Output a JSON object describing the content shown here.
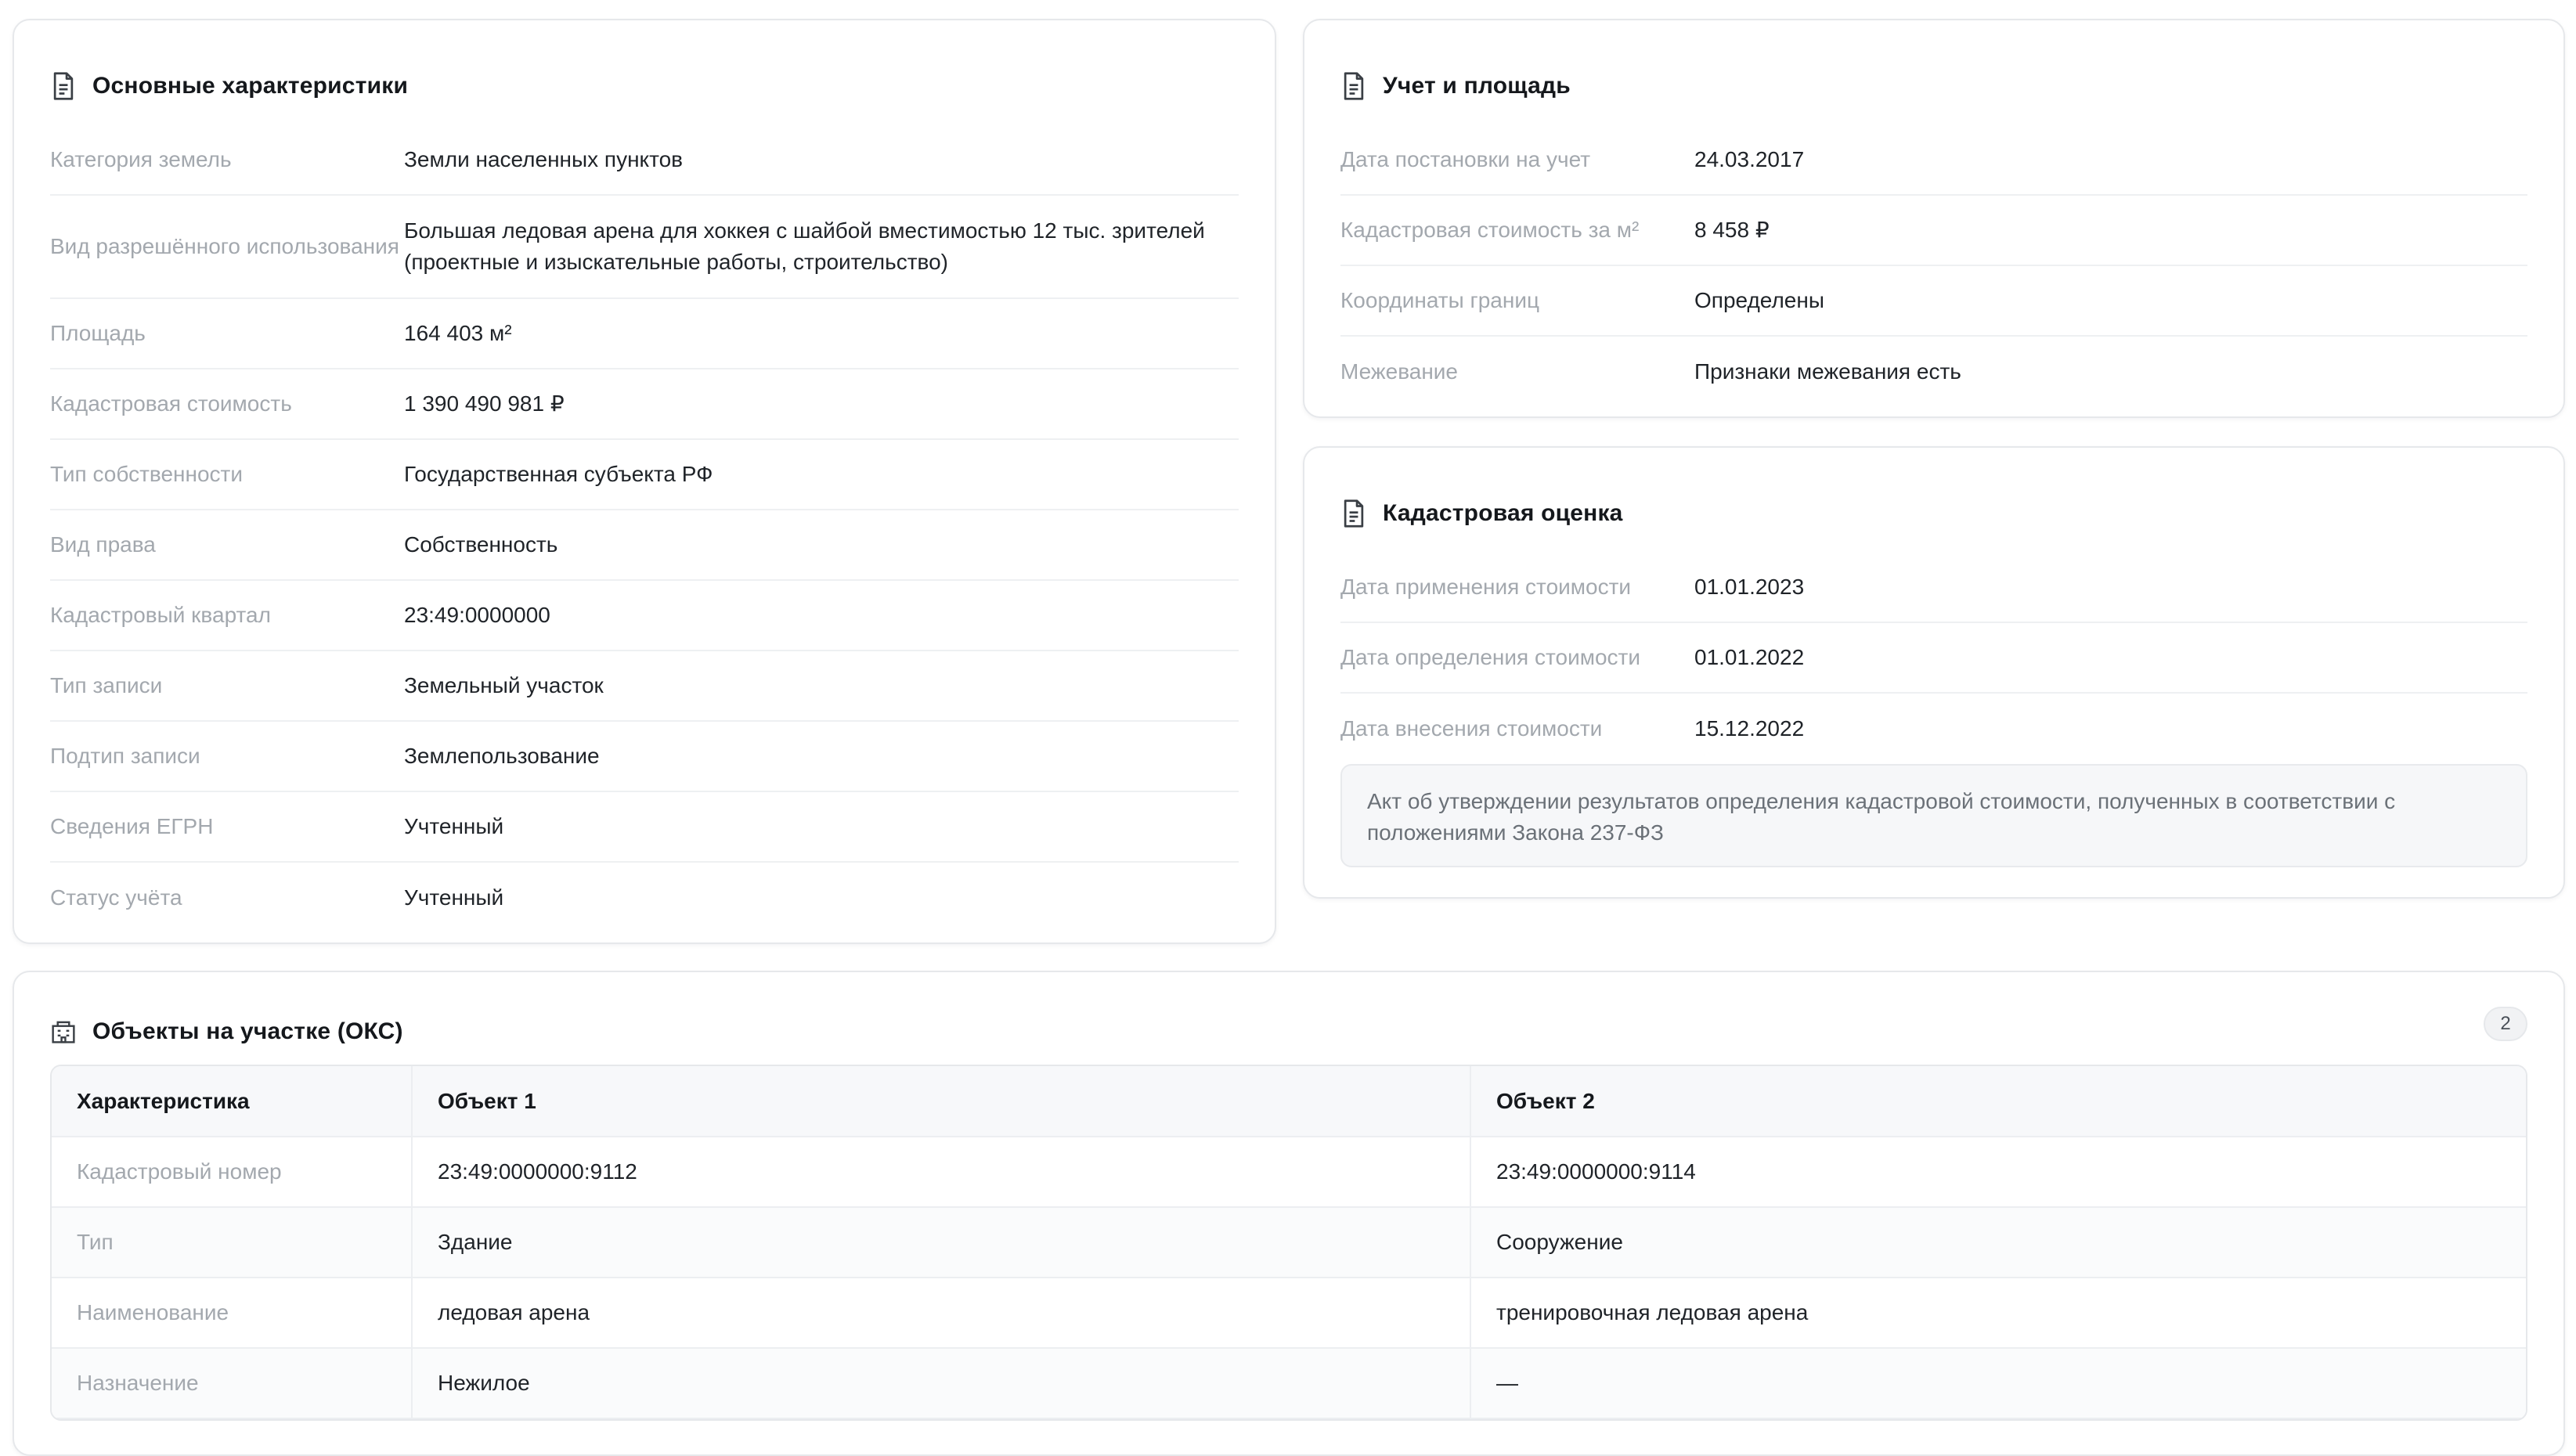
{
  "main": {
    "title": "Основные характеристики",
    "icon": "document-icon",
    "rows": [
      {
        "label": "Категория земель",
        "value": "Земли населенных пунктов"
      },
      {
        "label": "Вид разрешённого использования",
        "value": "Большая ледовая арена для хоккея с шайбой вместимостью 12 тыс. зрителей (проектные и изыскательные работы, строительство)"
      },
      {
        "label": "Площадь",
        "value": "164 403 м²"
      },
      {
        "label": "Кадастровая стоимость",
        "value": "1 390 490 981 ₽"
      },
      {
        "label": "Тип собственности",
        "value": "Государственная субъекта РФ"
      },
      {
        "label": "Вид права",
        "value": "Собственность"
      },
      {
        "label": "Кадастровый квартал",
        "value": "23:49:0000000"
      },
      {
        "label": "Тип записи",
        "value": "Земельный участок"
      },
      {
        "label": "Подтип записи",
        "value": "Землепользование"
      },
      {
        "label": "Сведения ЕГРН",
        "value": "Учтенный"
      },
      {
        "label": "Статус учёта",
        "value": "Учтенный"
      }
    ]
  },
  "registration": {
    "title": "Учет и площадь",
    "icon": "document-icon",
    "rows": [
      {
        "label": "Дата постановки на учет",
        "value": "24.03.2017"
      },
      {
        "label": "Кадастровая стоимость за м²",
        "value": "8 458 ₽"
      },
      {
        "label": "Координаты границ",
        "value": "Определены"
      },
      {
        "label": "Межевание",
        "value": "Признаки межевания есть"
      }
    ]
  },
  "evaluation": {
    "title": "Кадастровая оценка",
    "icon": "document-icon",
    "rows": [
      {
        "label": "Дата применения стоимости",
        "value": "01.01.2023"
      },
      {
        "label": "Дата определения стоимости",
        "value": "01.01.2022"
      },
      {
        "label": "Дата внесения стоимости",
        "value": "15.12.2022"
      }
    ],
    "note": "Акт об утверждении результатов определения кадастровой стоимости, полученных в соответствии с положениями Закона 237-ФЗ"
  },
  "objects": {
    "title": "Объекты на участке (ОКС)",
    "icon": "building-icon",
    "count": "2",
    "columns": [
      "Характеристика",
      "Объект 1",
      "Объект 2"
    ],
    "rows": [
      [
        "Кадастровый номер",
        "23:49:0000000:9112",
        "23:49:0000000:9114"
      ],
      [
        "Тип",
        "Здание",
        "Сооружение"
      ],
      [
        "Наименование",
        "ледовая арена",
        "тренировочная ледовая арена"
      ],
      [
        "Назначение",
        "Нежилое",
        "—"
      ]
    ]
  }
}
